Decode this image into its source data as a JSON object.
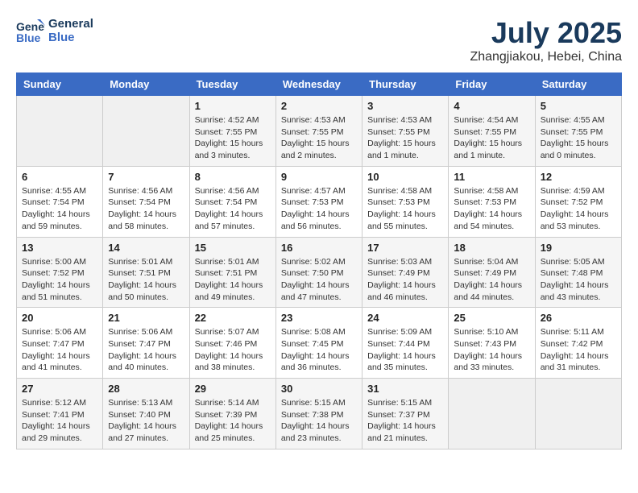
{
  "logo": {
    "line1": "General",
    "line2": "Blue"
  },
  "title": "July 2025",
  "location": "Zhangjiakou, Hebei, China",
  "weekdays": [
    "Sunday",
    "Monday",
    "Tuesday",
    "Wednesday",
    "Thursday",
    "Friday",
    "Saturday"
  ],
  "weeks": [
    [
      {
        "day": "",
        "info": ""
      },
      {
        "day": "",
        "info": ""
      },
      {
        "day": "1",
        "info": "Sunrise: 4:52 AM\nSunset: 7:55 PM\nDaylight: 15 hours\nand 3 minutes."
      },
      {
        "day": "2",
        "info": "Sunrise: 4:53 AM\nSunset: 7:55 PM\nDaylight: 15 hours\nand 2 minutes."
      },
      {
        "day": "3",
        "info": "Sunrise: 4:53 AM\nSunset: 7:55 PM\nDaylight: 15 hours\nand 1 minute."
      },
      {
        "day": "4",
        "info": "Sunrise: 4:54 AM\nSunset: 7:55 PM\nDaylight: 15 hours\nand 1 minute."
      },
      {
        "day": "5",
        "info": "Sunrise: 4:55 AM\nSunset: 7:55 PM\nDaylight: 15 hours\nand 0 minutes."
      }
    ],
    [
      {
        "day": "6",
        "info": "Sunrise: 4:55 AM\nSunset: 7:54 PM\nDaylight: 14 hours\nand 59 minutes."
      },
      {
        "day": "7",
        "info": "Sunrise: 4:56 AM\nSunset: 7:54 PM\nDaylight: 14 hours\nand 58 minutes."
      },
      {
        "day": "8",
        "info": "Sunrise: 4:56 AM\nSunset: 7:54 PM\nDaylight: 14 hours\nand 57 minutes."
      },
      {
        "day": "9",
        "info": "Sunrise: 4:57 AM\nSunset: 7:53 PM\nDaylight: 14 hours\nand 56 minutes."
      },
      {
        "day": "10",
        "info": "Sunrise: 4:58 AM\nSunset: 7:53 PM\nDaylight: 14 hours\nand 55 minutes."
      },
      {
        "day": "11",
        "info": "Sunrise: 4:58 AM\nSunset: 7:53 PM\nDaylight: 14 hours\nand 54 minutes."
      },
      {
        "day": "12",
        "info": "Sunrise: 4:59 AM\nSunset: 7:52 PM\nDaylight: 14 hours\nand 53 minutes."
      }
    ],
    [
      {
        "day": "13",
        "info": "Sunrise: 5:00 AM\nSunset: 7:52 PM\nDaylight: 14 hours\nand 51 minutes."
      },
      {
        "day": "14",
        "info": "Sunrise: 5:01 AM\nSunset: 7:51 PM\nDaylight: 14 hours\nand 50 minutes."
      },
      {
        "day": "15",
        "info": "Sunrise: 5:01 AM\nSunset: 7:51 PM\nDaylight: 14 hours\nand 49 minutes."
      },
      {
        "day": "16",
        "info": "Sunrise: 5:02 AM\nSunset: 7:50 PM\nDaylight: 14 hours\nand 47 minutes."
      },
      {
        "day": "17",
        "info": "Sunrise: 5:03 AM\nSunset: 7:49 PM\nDaylight: 14 hours\nand 46 minutes."
      },
      {
        "day": "18",
        "info": "Sunrise: 5:04 AM\nSunset: 7:49 PM\nDaylight: 14 hours\nand 44 minutes."
      },
      {
        "day": "19",
        "info": "Sunrise: 5:05 AM\nSunset: 7:48 PM\nDaylight: 14 hours\nand 43 minutes."
      }
    ],
    [
      {
        "day": "20",
        "info": "Sunrise: 5:06 AM\nSunset: 7:47 PM\nDaylight: 14 hours\nand 41 minutes."
      },
      {
        "day": "21",
        "info": "Sunrise: 5:06 AM\nSunset: 7:47 PM\nDaylight: 14 hours\nand 40 minutes."
      },
      {
        "day": "22",
        "info": "Sunrise: 5:07 AM\nSunset: 7:46 PM\nDaylight: 14 hours\nand 38 minutes."
      },
      {
        "day": "23",
        "info": "Sunrise: 5:08 AM\nSunset: 7:45 PM\nDaylight: 14 hours\nand 36 minutes."
      },
      {
        "day": "24",
        "info": "Sunrise: 5:09 AM\nSunset: 7:44 PM\nDaylight: 14 hours\nand 35 minutes."
      },
      {
        "day": "25",
        "info": "Sunrise: 5:10 AM\nSunset: 7:43 PM\nDaylight: 14 hours\nand 33 minutes."
      },
      {
        "day": "26",
        "info": "Sunrise: 5:11 AM\nSunset: 7:42 PM\nDaylight: 14 hours\nand 31 minutes."
      }
    ],
    [
      {
        "day": "27",
        "info": "Sunrise: 5:12 AM\nSunset: 7:41 PM\nDaylight: 14 hours\nand 29 minutes."
      },
      {
        "day": "28",
        "info": "Sunrise: 5:13 AM\nSunset: 7:40 PM\nDaylight: 14 hours\nand 27 minutes."
      },
      {
        "day": "29",
        "info": "Sunrise: 5:14 AM\nSunset: 7:39 PM\nDaylight: 14 hours\nand 25 minutes."
      },
      {
        "day": "30",
        "info": "Sunrise: 5:15 AM\nSunset: 7:38 PM\nDaylight: 14 hours\nand 23 minutes."
      },
      {
        "day": "31",
        "info": "Sunrise: 5:15 AM\nSunset: 7:37 PM\nDaylight: 14 hours\nand 21 minutes."
      },
      {
        "day": "",
        "info": ""
      },
      {
        "day": "",
        "info": ""
      }
    ]
  ]
}
